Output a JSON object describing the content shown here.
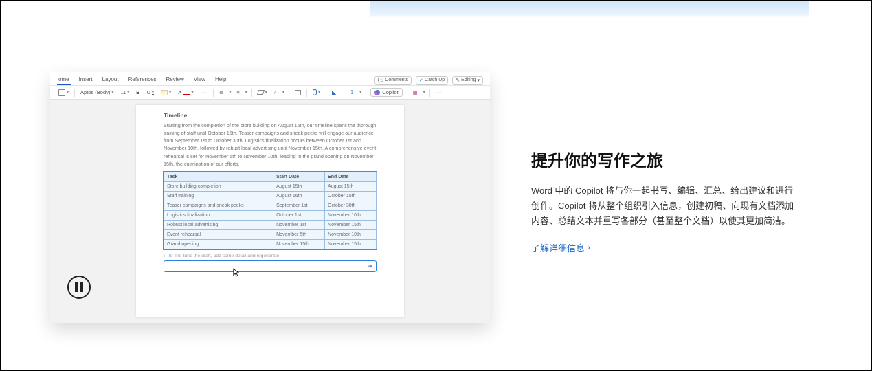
{
  "menu": {
    "tabs": [
      "ome",
      "Insert",
      "Layout",
      "References",
      "Review",
      "View",
      "Help"
    ],
    "right": {
      "comments": "Comments",
      "catchup": "Catch Up",
      "editing": "Editing"
    }
  },
  "toolbar": {
    "font": "Aptos (Body)",
    "size": "11",
    "bold": "B",
    "underline": "U",
    "textA": "A",
    "more": "···",
    "copilot": "Copilot"
  },
  "doc": {
    "heading": "Timeline",
    "body": "Starting from the completion of the store building on August 15th, our timeline spans the thorough training of staff until October 15th. Teaser campaigns and sneak peeks will engage our audience from September 1st to October 30th. Logistics finalization occurs between October 1st and November 10th, followed by robust local advertising until November 15th. A comprehensive event rehearsal is set for November 5th to November 10th, leading to the grand opening on November 15th, the culmination of our efforts.",
    "table": {
      "headers": [
        "Task",
        "Start Date",
        "End Date"
      ],
      "rows": [
        [
          "Store building completion",
          "August 15th",
          "August 15th"
        ],
        [
          "Staff training",
          "August 16th",
          "October 15th"
        ],
        [
          "Teaser campaigns and sneak peeks",
          "September 1st",
          "October 30th"
        ],
        [
          "Logistics finalization",
          "October 1st",
          "November 10th"
        ],
        [
          "Robust local advertising",
          "November 1st",
          "November 15th"
        ],
        [
          "Event rehearsal",
          "November 5th",
          "November 10th"
        ],
        [
          "Grand opening",
          "November 15th",
          "November 15th"
        ]
      ]
    },
    "hint": "To fine-tune the draft, add some detail and regenerate"
  },
  "promo": {
    "heading": "提升你的写作之旅",
    "desc": "Word 中的 Copilot 将与你一起书写、编辑、汇总、给出建议和进行创作。Copilot 将从整个组织引入信息，创建初稿、向现有文档添加内容、总结文本并重写各部分（甚至整个文档）以使其更加简洁。",
    "link": "了解详细信息"
  }
}
